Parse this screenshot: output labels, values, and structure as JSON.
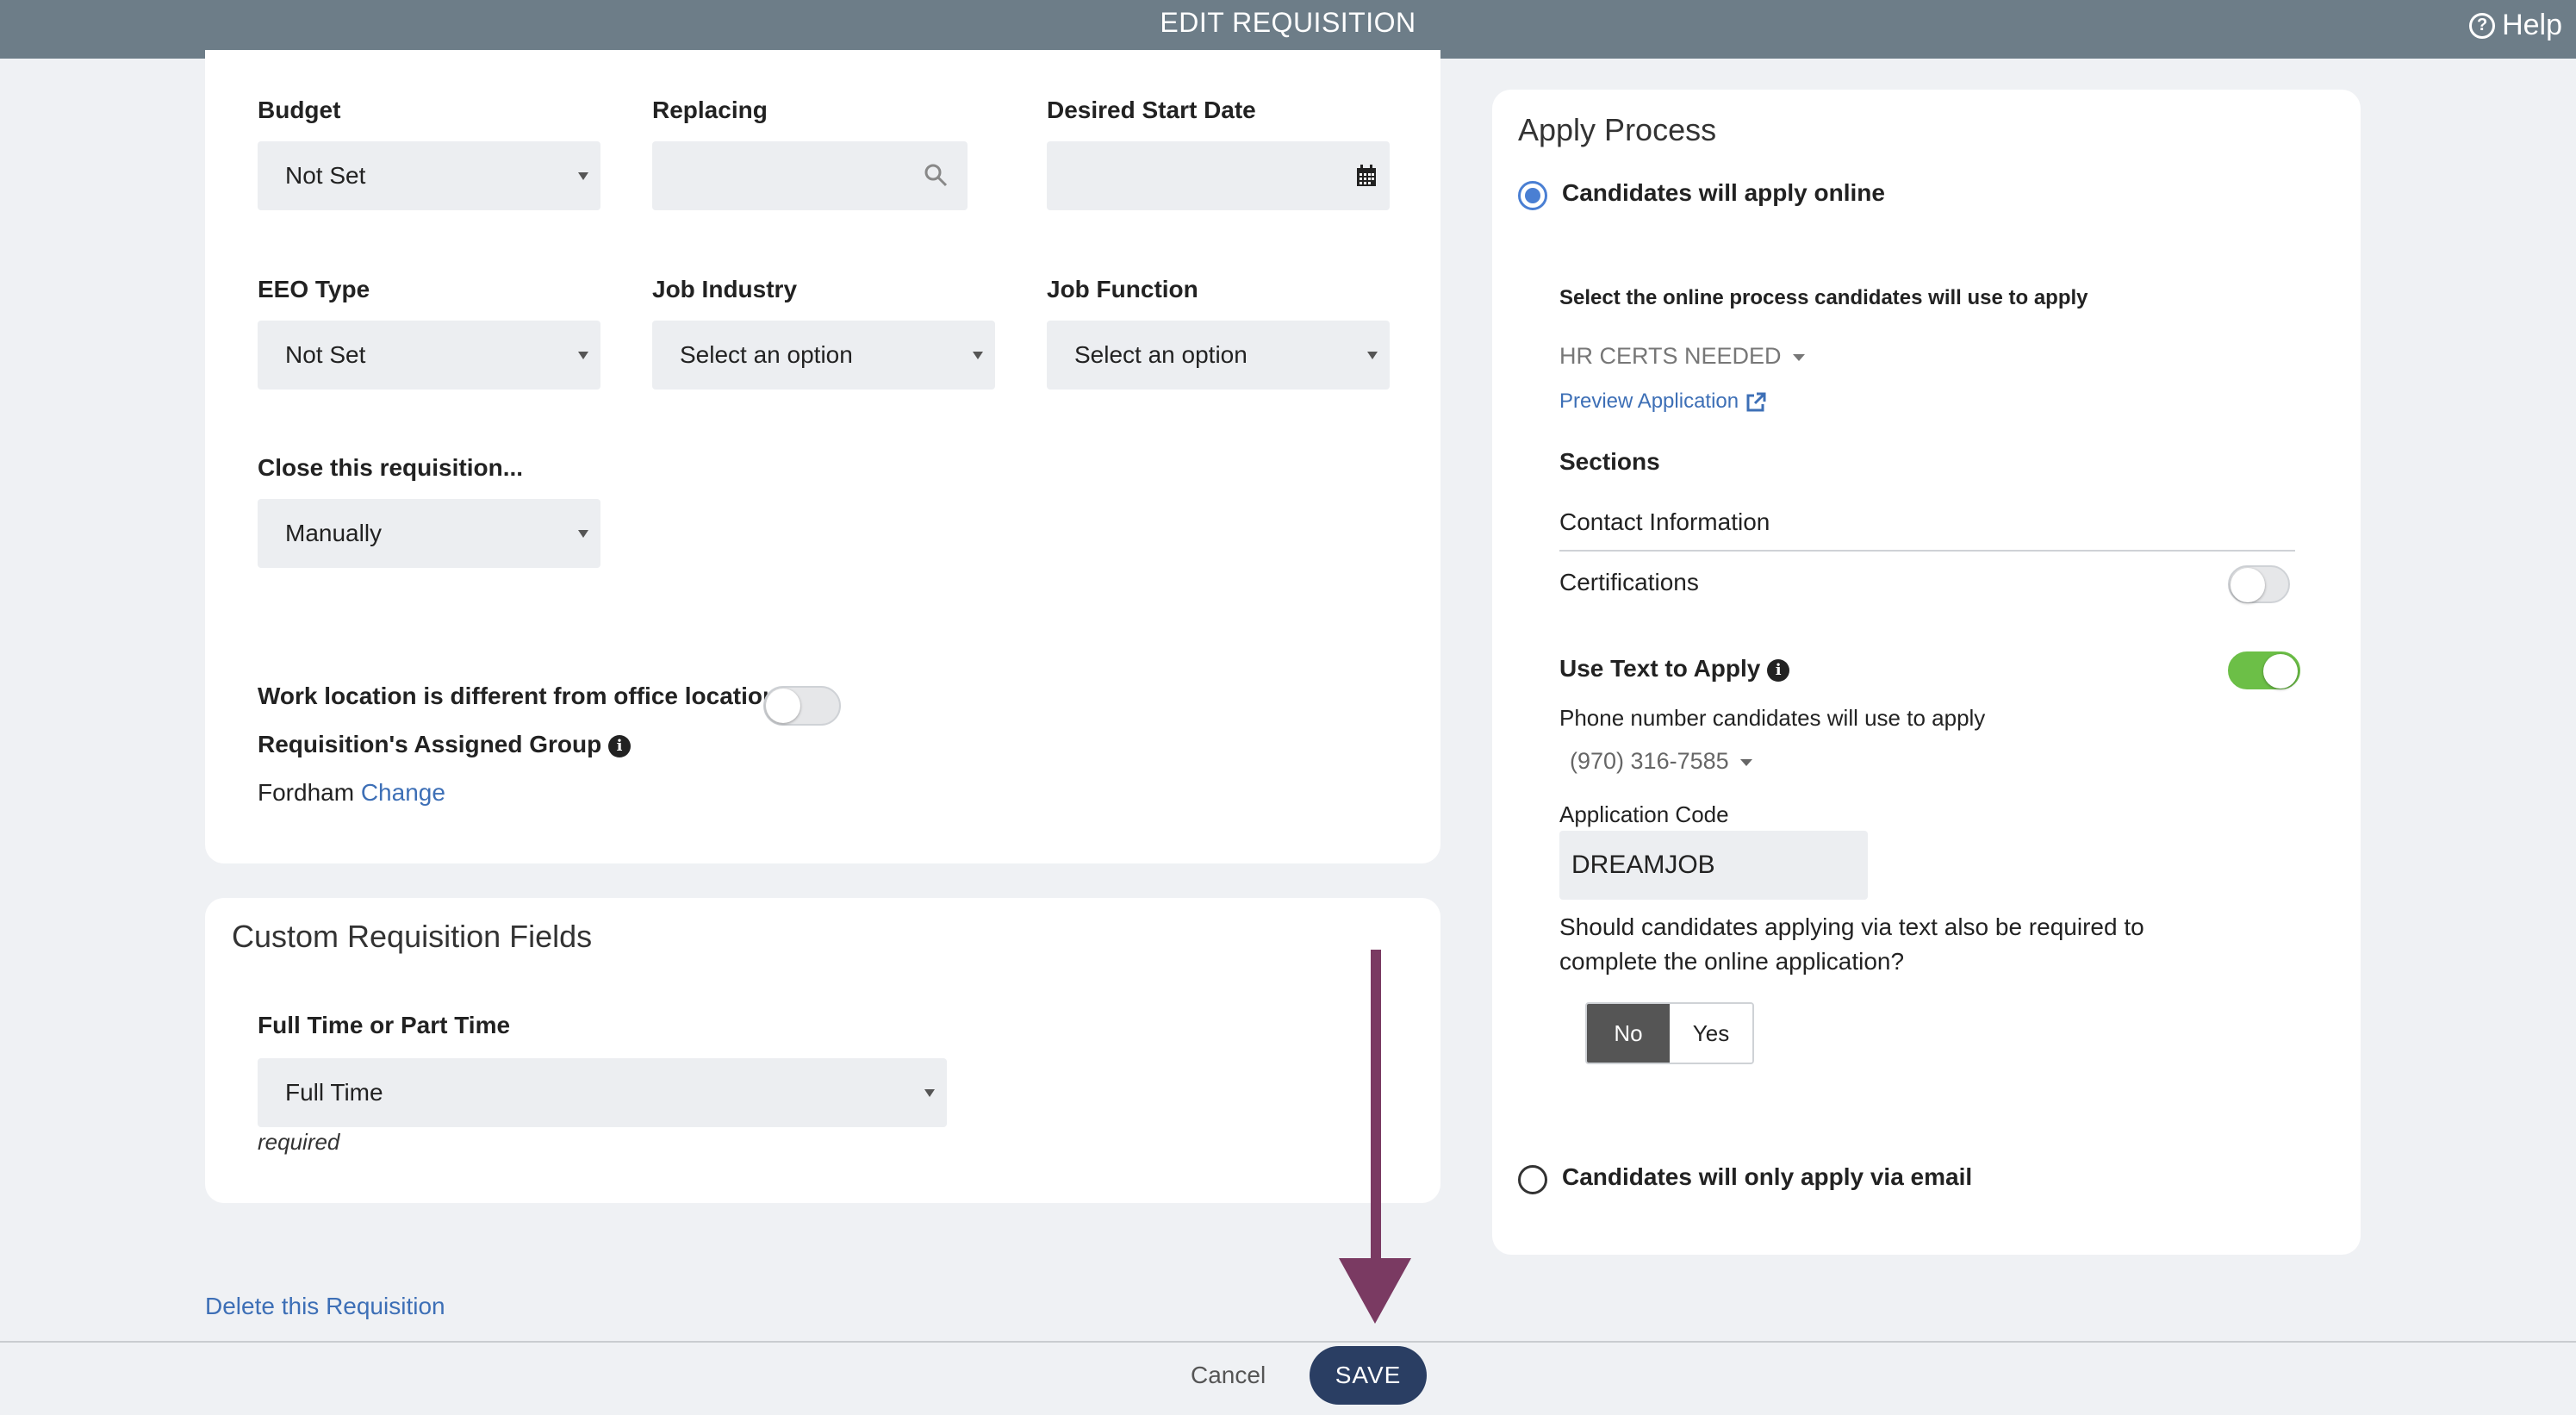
{
  "header": {
    "title": "EDIT REQUISITION",
    "help_label": "Help",
    "help_icon": "question-circle-icon"
  },
  "main_form": {
    "budget": {
      "label": "Budget",
      "value": "Not Set"
    },
    "replacing": {
      "label": "Replacing",
      "value": ""
    },
    "desired_start_date": {
      "label": "Desired Start Date",
      "value": ""
    },
    "eeo_type": {
      "label": "EEO Type",
      "value": "Not Set"
    },
    "job_industry": {
      "label": "Job Industry",
      "value": "Select an option"
    },
    "job_function": {
      "label": "Job Function",
      "value": "Select an option"
    },
    "close_requisition": {
      "label": "Close this requisition...",
      "value": "Manually"
    },
    "work_location": {
      "label": "Work location is different from office location",
      "enabled": false
    },
    "assigned_group": {
      "label": "Requisition's Assigned Group",
      "value": "Fordham",
      "change_label": "Change"
    }
  },
  "custom_fields": {
    "title": "Custom Requisition Fields",
    "full_time_part_time": {
      "label": "Full Time or Part Time",
      "value": "Full Time",
      "note": "required"
    }
  },
  "apply_process": {
    "title": "Apply Process",
    "online_option": {
      "label": "Candidates will apply online",
      "selected": true
    },
    "select_process_label": "Select the online process candidates will use to apply",
    "process_value": "HR CERTS NEEDED",
    "preview_label": "Preview Application",
    "sections_label": "Sections",
    "sections": [
      {
        "name": "Contact Information"
      },
      {
        "name": "Certifications",
        "enabled": false
      }
    ],
    "text_to_apply": {
      "label": "Use Text to Apply",
      "enabled": true
    },
    "phone_label": "Phone number candidates will use to apply",
    "phone_value": "(970) 316-7585",
    "app_code_label": "Application Code",
    "app_code_value": "DREAMJOB",
    "require_online_question": "Should candidates applying via text also be required to",
    "require_online_question_2": "complete the online application?",
    "no_label": "No",
    "yes_label": "Yes",
    "require_online_selected": "No",
    "email_option": {
      "label": "Candidates will only apply via email",
      "selected": false
    }
  },
  "actions": {
    "delete_label": "Delete this Requisition",
    "cancel_label": "Cancel",
    "save_label": "SAVE"
  },
  "colors": {
    "header_bg": "#6d7d88",
    "save_button": "#2a3e63",
    "link": "#3d6fb6",
    "toggle_on": "#6cbf47",
    "annotation_arrow": "#7a3a62"
  }
}
